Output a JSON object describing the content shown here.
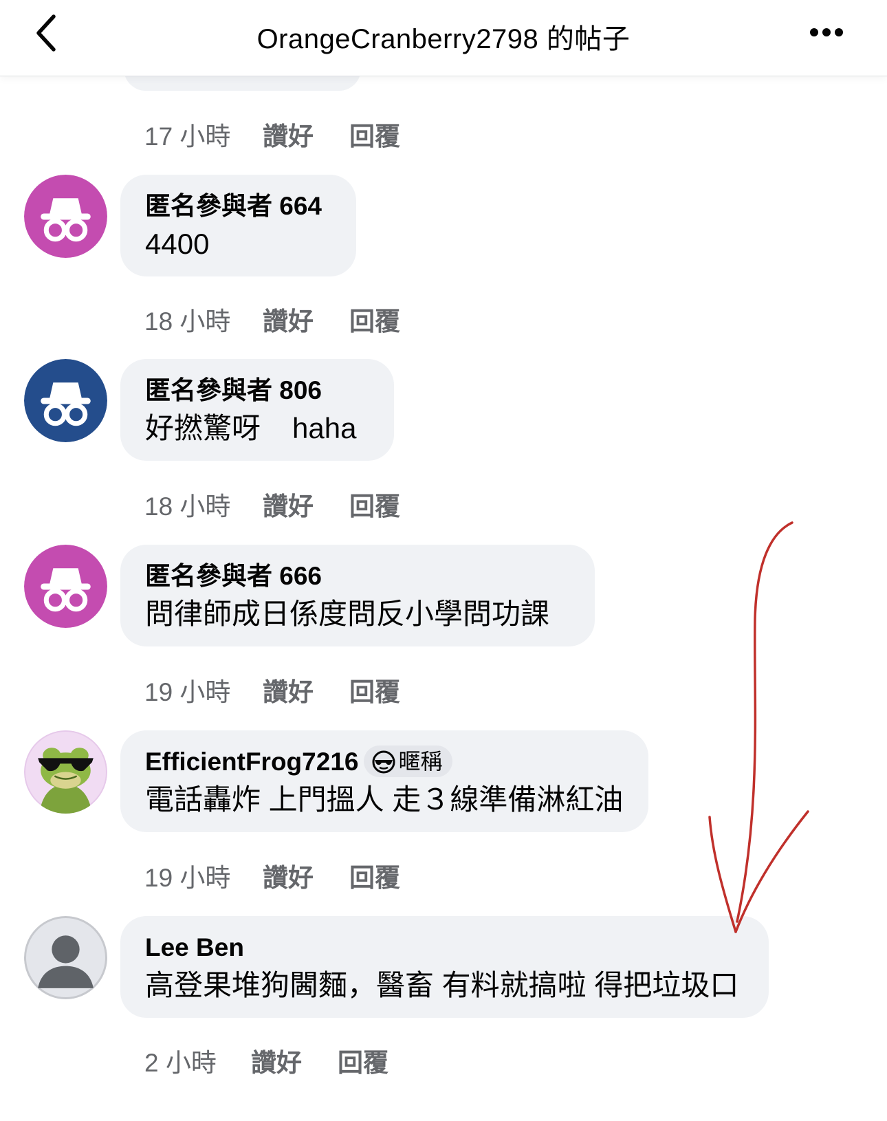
{
  "header": {
    "title": "OrangeCranberry2798 的帖子"
  },
  "top_meta": {
    "time": "17 小時",
    "like": "讚好",
    "reply": "回覆"
  },
  "comments": [
    {
      "author": "匿名參與者 664",
      "text": "4400",
      "time": "18 小時",
      "like": "讚好",
      "reply": "回覆",
      "avatar_color": "#c44cb0"
    },
    {
      "author": "匿名參與者 806",
      "text_a": "好撚驚呀",
      "text_b": "haha",
      "time": "18 小時",
      "like": "讚好",
      "reply": "回覆",
      "avatar_color": "#244d8c"
    },
    {
      "author": "匿名參與者 666",
      "text": "問律師成日係度問反小學問功課",
      "time": "19 小時",
      "like": "讚好",
      "reply": "回覆",
      "avatar_color": "#c44cb0"
    },
    {
      "author": "EfficientFrog7216",
      "badge": "暱稱",
      "text": "電話轟炸 上門搵人 走３線準備淋紅油",
      "time": "19 小時",
      "like": "讚好",
      "reply": "回覆"
    },
    {
      "author": "Lee Ben",
      "text": "高登果堆狗閪麵，醫畜 有料就搞啦 得把垃圾口",
      "time": "2 小時",
      "like": "讚好",
      "reply": "回覆"
    }
  ],
  "annotation_color": "#c0302b"
}
